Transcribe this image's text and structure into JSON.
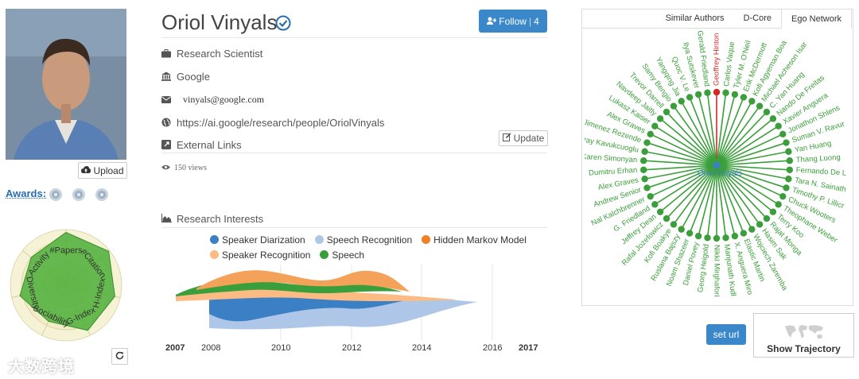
{
  "profile": {
    "name": "Oriol Vinyals",
    "position": "Research Scientist",
    "affiliation": "Google",
    "email": "vinyals@google.com",
    "homepage": "https://ai.google/research/people/OriolVinyals",
    "external_links_label": "External Links",
    "views": "150 views"
  },
  "buttons": {
    "upload": "Upload",
    "follow": "Follow",
    "follow_count": "4",
    "update": "Update",
    "set_url": "set url",
    "show_trajectory": "Show Trajectory"
  },
  "awards": {
    "label": "Awards:",
    "badge_count": 3
  },
  "radar": {
    "axes": [
      "#Papers",
      "#Citation",
      "H-Index",
      "G-Index",
      "Sociability",
      "Diversity",
      "Activity"
    ],
    "values": [
      0.95,
      0.98,
      0.9,
      0.9,
      0.72,
      0.85,
      0.8
    ]
  },
  "research_interests": {
    "title": "Research Interests",
    "legend": [
      {
        "name": "Speaker Diarization",
        "color": "#3b7fc4"
      },
      {
        "name": "Speech Recognition",
        "color": "#aec7e8"
      },
      {
        "name": "Hidden Markov Model",
        "color": "#f07f26"
      },
      {
        "name": "Speaker Recognition",
        "color": "#fdbb84"
      },
      {
        "name": "Speech",
        "color": "#3a9f3a"
      }
    ],
    "years": [
      "2007",
      "2008",
      "2010",
      "2012",
      "2014",
      "2016",
      "2017"
    ]
  },
  "ego_network": {
    "tabs": [
      "Similar Authors",
      "D-Core",
      "Ego Network"
    ],
    "active_tab": "Ego Network",
    "center": "Oriol Vinyals",
    "highlighted": "Geoffrey Hinton",
    "center_color": "#3b7fc4",
    "node_color": "#3a9f3a",
    "highlight_color": "#d62728",
    "nodes": [
      "Geoffrey Hinton",
      "Carlos Vaque",
      "Tyler M. O'Neil",
      "Erik McDermott",
      "Kofi Agyeman Boa",
      "Michael Acheson Isar",
      "C. Yan Huang",
      "Nando De Freitas",
      "Xavier Anguera",
      "Jonathon Shlens",
      "Suman V. Ravur",
      "Yan Huang",
      "Thang Luong",
      "Fernando De L",
      "Tara N. Sainath",
      "Timothy P. Lillicr",
      "Chuck Wooters",
      "Theophane Weber",
      "Terry Koo",
      "Rajat Monga",
      "Hasim Sak",
      "Wojciech Zaremba",
      "Elastic Martin",
      "X. Anguera Miro",
      "Manjunath Kudl",
      "Nikki Mirghafori",
      "Georg Heigold",
      "Daniel Povey",
      "Noam Shazeer",
      "Ruslana Bajszy",
      "Kofi Boakye",
      "Rafal Jozefowicz",
      "Jeffrey Dean",
      "G. Friedland",
      "Nal Kalchbrenner",
      "Andrew Senior",
      "Alex Graves",
      "Dumitru Erhan",
      "Karen Simonyan",
      "Koray Kavukcuoglu",
      "Jimenez Rezende",
      "Alex Graves",
      "Lukasz Kaiser",
      "Navdeep Jaitly",
      "Trevor Darrell",
      "Samy Bengio",
      "Yangqing Jia",
      "Quoc V. Le",
      "Ilya Sutskever",
      "Gerald Friedland"
    ]
  },
  "watermark": "大数跨境"
}
